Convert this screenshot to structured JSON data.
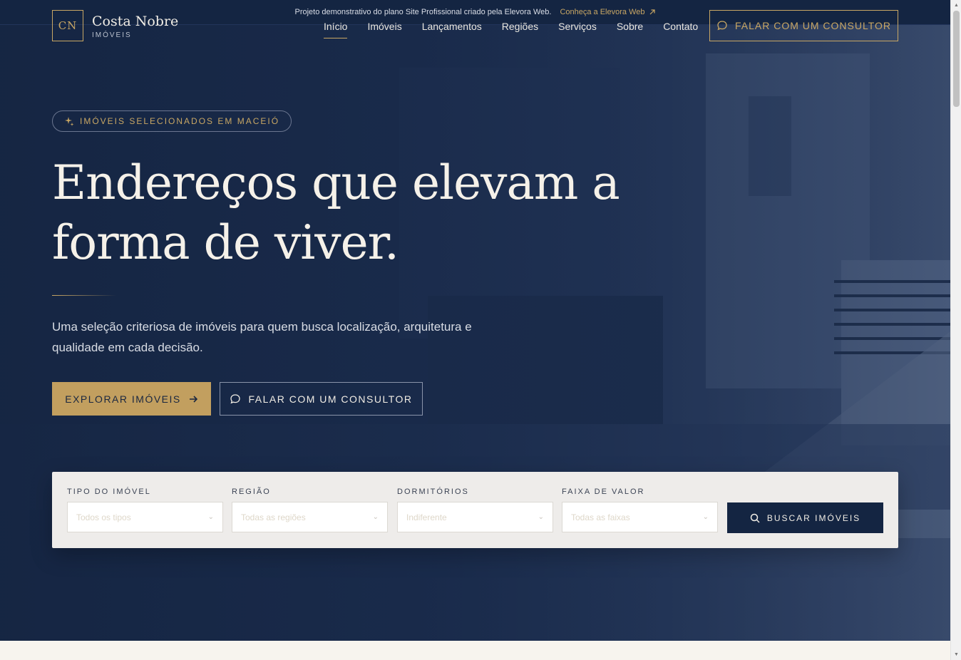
{
  "topbar": {
    "text": "Projeto demonstrativo do plano Site Profissional criado pela Elevora Web.",
    "link_label": "Conheça a Elevora Web",
    "link_icon": "arrow-up-right-icon"
  },
  "header": {
    "logo_mark": "CN",
    "logo_name": "Costa Nobre",
    "logo_sub": "IMÓVEIS",
    "nav": [
      "Início",
      "Imóveis",
      "Lançamentos",
      "Regiões",
      "Serviços",
      "Sobre",
      "Contato"
    ],
    "active_nav": "Início",
    "cta_label": "FALAR COM UM CONSULTOR"
  },
  "hero": {
    "badge": "IMÓVEIS SELECIONADOS EM MACEIÓ",
    "headline_line1": "Endereços que elevam a",
    "headline_line2": "forma de viver.",
    "lead": "Uma seleção criteriosa de imóveis para quem busca localização, arquitetura e qualidade em cada decisão.",
    "primary_button": "EXPLORAR IMÓVEIS",
    "secondary_button": "FALAR COM UM CONSULTOR"
  },
  "search": {
    "fields": [
      {
        "label": "TIPO DO IMÓVEL",
        "value": "Todos os tipos"
      },
      {
        "label": "REGIÃO",
        "value": "Todas as regiões"
      },
      {
        "label": "DORMITÓRIOS",
        "value": "Indiferente"
      },
      {
        "label": "FAIXA DE VALOR",
        "value": "Todas as faixas"
      }
    ],
    "button": "BUSCAR IMÓVEIS"
  },
  "colors": {
    "navy": "#142542",
    "gold": "#c9a764",
    "cream": "#f6f3ee"
  }
}
